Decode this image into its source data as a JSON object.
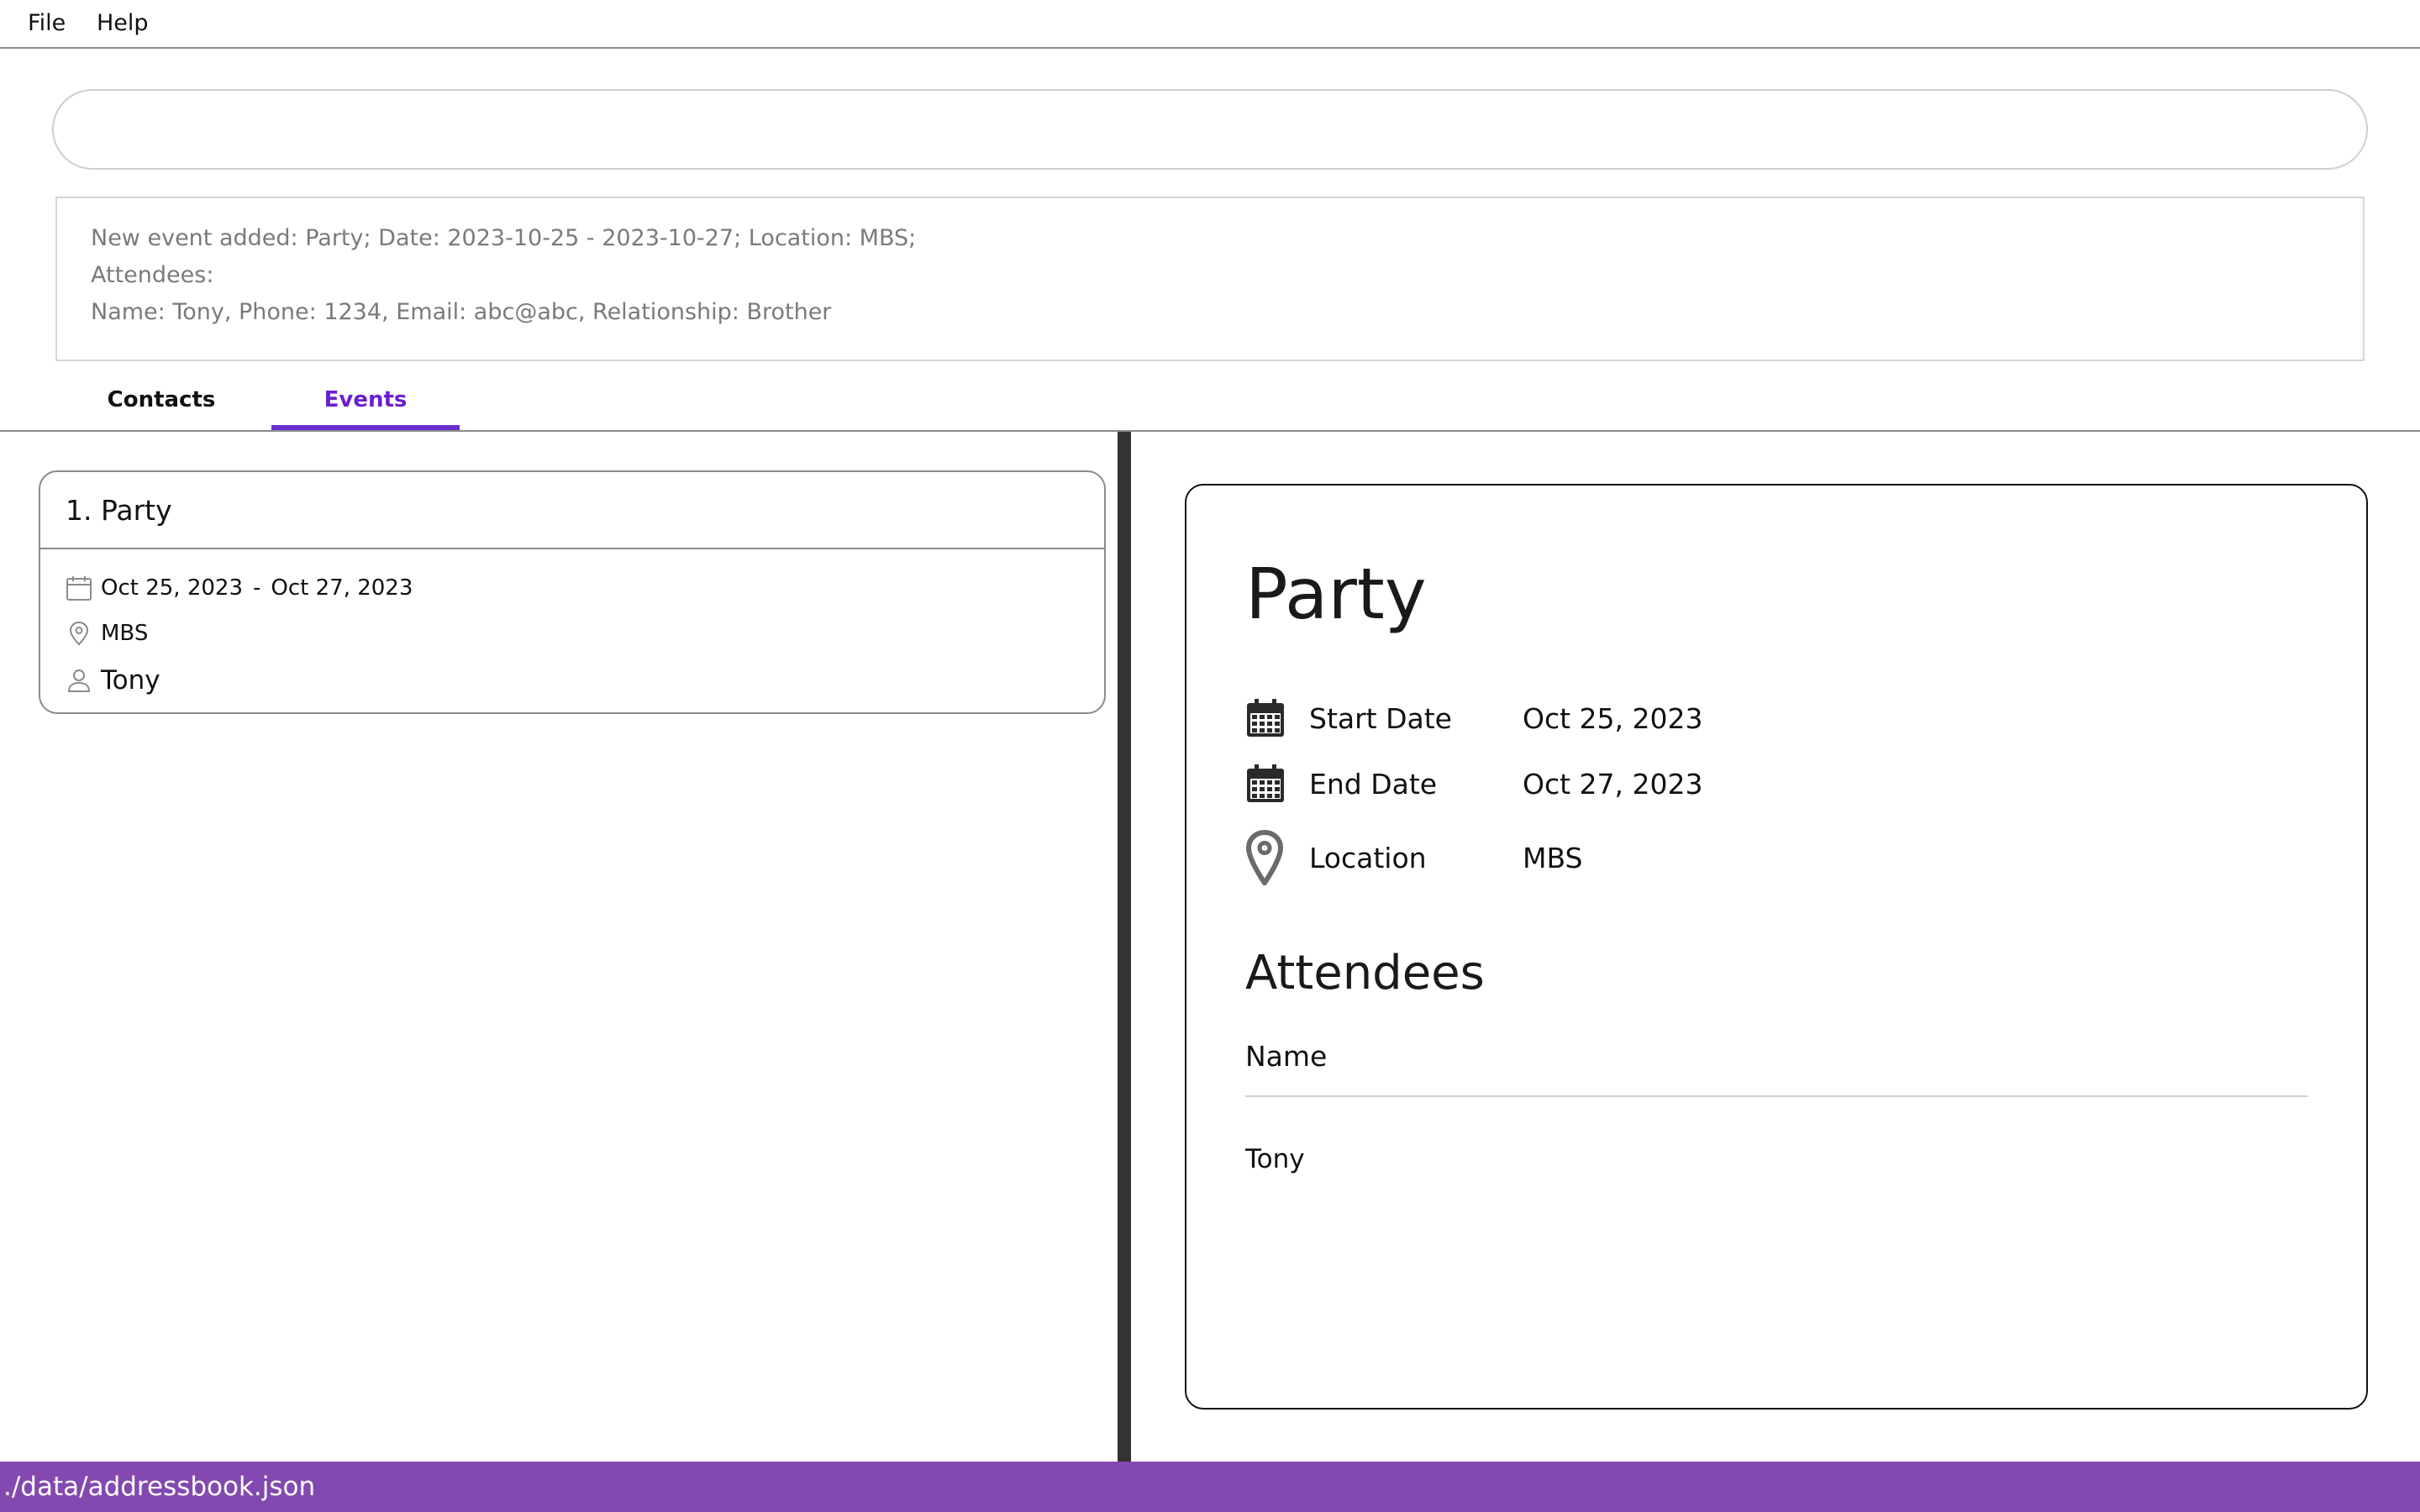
{
  "menu": {
    "file": "File",
    "help": "Help"
  },
  "command": {
    "value": "",
    "placeholder": ""
  },
  "result": {
    "lines": [
      "New event added: Party; Date: 2023-10-25 - 2023-10-27; Location: MBS;",
      "Attendees:",
      "Name: Tony, Phone: 1234, Email: abc@abc, Relationship: Brother"
    ]
  },
  "tabs": [
    {
      "label": "Contacts",
      "active": false
    },
    {
      "label": "Events",
      "active": true
    }
  ],
  "event_list": [
    {
      "title": "1. Party",
      "start": "Oct 25, 2023",
      "separator": "-",
      "end": "Oct 27, 2023",
      "location": "MBS",
      "attendees": [
        "Tony"
      ]
    }
  ],
  "details": {
    "title": "Party",
    "start_label": "Start Date",
    "start_value": "Oct 25, 2023",
    "end_label": "End Date",
    "end_value": "Oct 27, 2023",
    "location_label": "Location",
    "location_value": "MBS",
    "attendees_heading": "Attendees",
    "column_name": "Name",
    "attendees": [
      "Tony"
    ]
  },
  "status_bar": {
    "path": "./data/addressbook.json"
  },
  "colors": {
    "accent": "#6a2fd0",
    "status_bar": "#8349b0",
    "divider": "#333333"
  },
  "icons": {
    "date": "calendar-icon",
    "location": "location-pin-icon",
    "attendee": "person-icon"
  }
}
